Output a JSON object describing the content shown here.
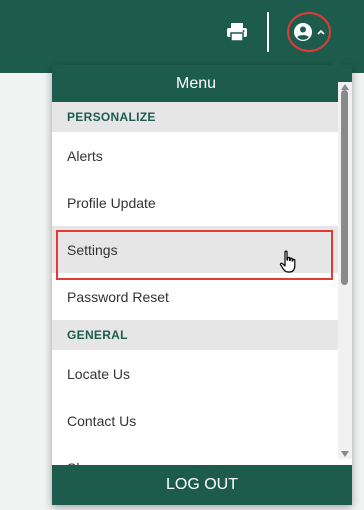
{
  "topbar": {
    "print_icon": "printer-icon",
    "user_icon": "account-circle-icon",
    "user_caret_icon": "chevron-up-icon"
  },
  "menu": {
    "title": "Menu",
    "sections": [
      {
        "heading": "PERSONALIZE",
        "items": [
          "Alerts",
          "Profile Update",
          "Settings",
          "Password Reset"
        ]
      },
      {
        "heading": "GENERAL",
        "items": [
          "Locate Us",
          "Contact Us",
          "Share"
        ]
      }
    ],
    "highlighted_item": "Settings",
    "logout_label": "LOG OUT"
  },
  "colors": {
    "brand_green": "#1d5c4d",
    "highlight_red": "#e53935",
    "section_bg": "#e6e6e6"
  }
}
